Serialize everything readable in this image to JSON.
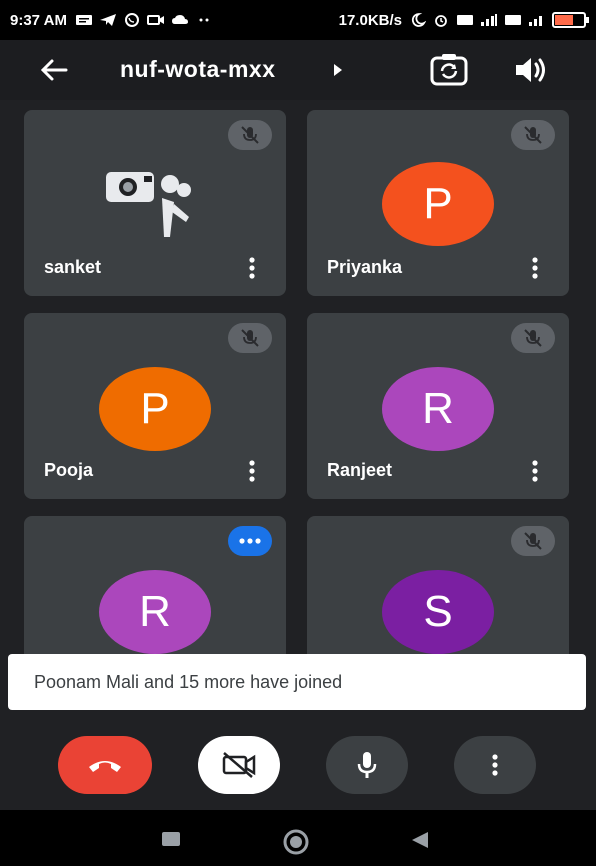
{
  "status_bar": {
    "time": "9:37 AM",
    "speed": "17.0KB/s",
    "battery_level": 0.6
  },
  "header": {
    "meeting_code": "nuf-wota-mxx",
    "icons": [
      "back-arrow-icon",
      "chevron-right-icon",
      "switch-camera-icon",
      "speaker-icon"
    ]
  },
  "participants": [
    {
      "name": "sanket",
      "initial": "",
      "avatar_color": "",
      "status": "muted",
      "has_image": true
    },
    {
      "name": "Priyanka",
      "initial": "P",
      "avatar_color": "#f4511e",
      "status": "muted"
    },
    {
      "name": "Pooja",
      "initial": "P",
      "avatar_color": "#ef6c00",
      "status": "muted"
    },
    {
      "name": "Ranjeet",
      "initial": "R",
      "avatar_color": "#ab47bc",
      "status": "muted"
    },
    {
      "name": "",
      "initial": "R",
      "avatar_color": "#ab47bc",
      "status": "speaking"
    },
    {
      "name": "",
      "initial": "S",
      "avatar_color": "#7b1fa2",
      "status": "muted"
    }
  ],
  "toast": {
    "message": "Poonam Mali and 15 more have joined"
  },
  "controls": {
    "end_call_color": "#ea4335",
    "camera_off_color": "#ffffff",
    "mic_color": "#3c4043",
    "more_color": "#3c4043"
  },
  "colors": {
    "background": "#202124",
    "tile": "#3c4043",
    "accent": "#1a73e8"
  }
}
